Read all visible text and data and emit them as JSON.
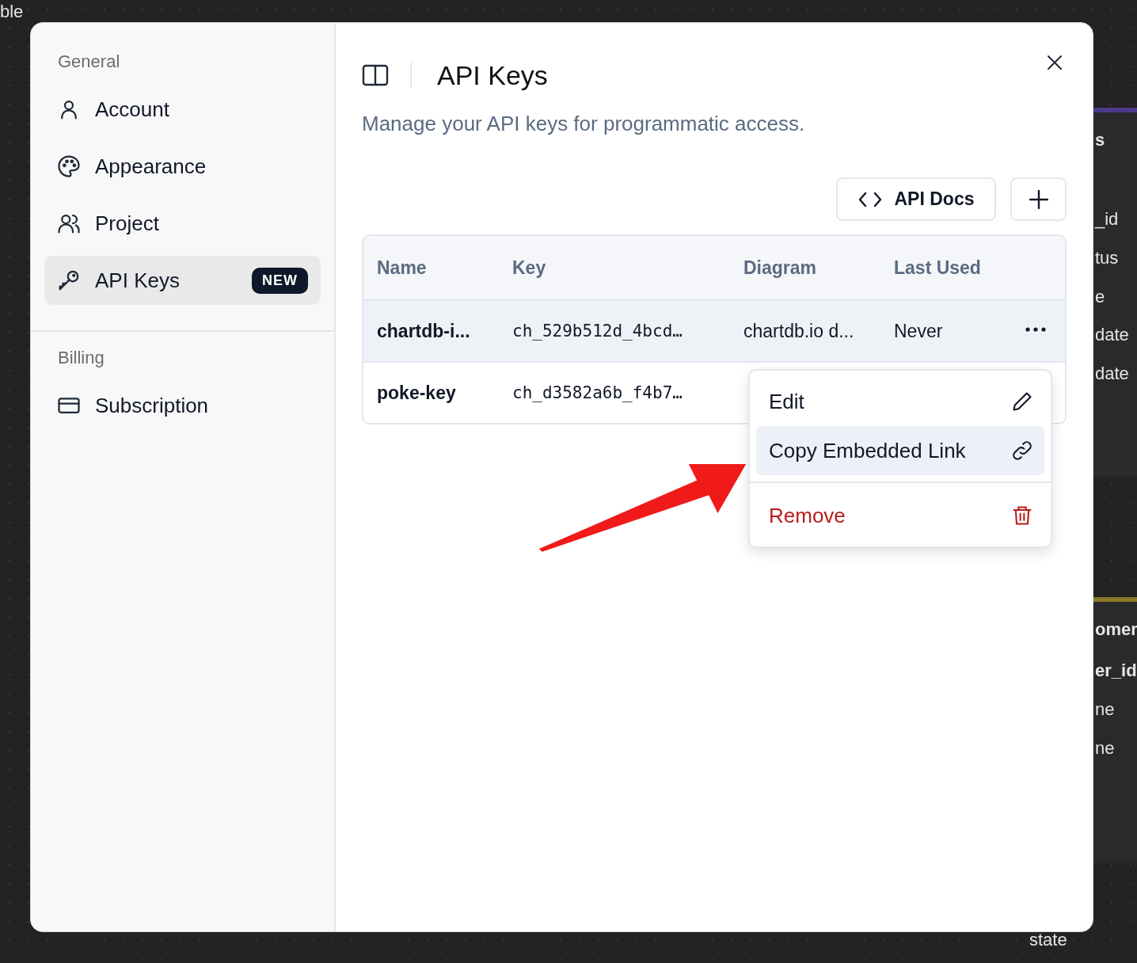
{
  "background": {
    "texts": [
      {
        "text": "ble"
      },
      {
        "text": "s"
      },
      {
        "text": "_id"
      },
      {
        "text": "tus"
      },
      {
        "text": "e"
      },
      {
        "text": "date"
      },
      {
        "text": "date"
      },
      {
        "text": "omer"
      },
      {
        "text": "er_id"
      },
      {
        "text": "ne"
      },
      {
        "text": "ne"
      },
      {
        "text": "state"
      }
    ]
  },
  "sidebar": {
    "sections": [
      {
        "title": "General",
        "items": [
          {
            "label": "Account",
            "selected": false
          },
          {
            "label": "Appearance",
            "selected": false
          },
          {
            "label": "Project",
            "selected": false
          },
          {
            "label": "API Keys",
            "selected": true,
            "badge": "NEW"
          }
        ]
      },
      {
        "title": "Billing",
        "items": [
          {
            "label": "Subscription",
            "selected": false
          }
        ]
      }
    ]
  },
  "header": {
    "title": "API Keys",
    "description": "Manage your API keys for programmatic access."
  },
  "toolbar": {
    "docs_button": "API Docs"
  },
  "table": {
    "columns": [
      "Name",
      "Key",
      "Diagram",
      "Last Used"
    ],
    "rows": [
      {
        "cells": [
          "chartdb-i...",
          "ch_529b512d_4bcd…",
          "chartdb.io d...",
          "Never"
        ],
        "selected": true
      },
      {
        "cells": [
          "poke-key",
          "ch_d3582a6b_f4b7…",
          "",
          ""
        ],
        "selected": false
      }
    ]
  },
  "menu": {
    "items": [
      {
        "label": "Edit",
        "kind": "normal",
        "selected": false
      },
      {
        "label": "Copy Embedded Link",
        "kind": "normal",
        "selected": true
      },
      {
        "label": "Remove",
        "kind": "danger",
        "selected": false
      }
    ]
  }
}
